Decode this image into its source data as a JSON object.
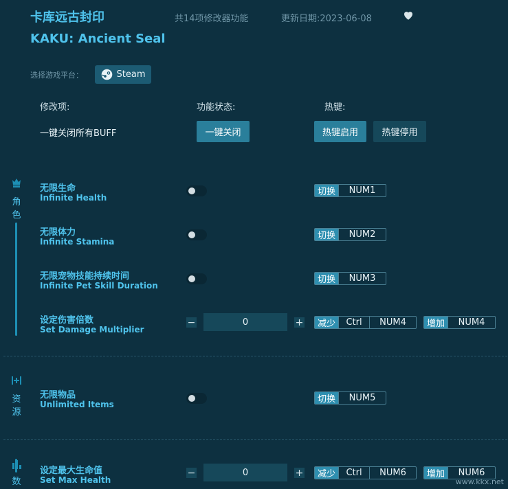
{
  "header": {
    "title_cn": "卡库远古封印",
    "title_en": "KAKU: Ancient Seal",
    "feature_count": "共14项修改器功能",
    "update_date": "更新日期:2023-06-08"
  },
  "platform": {
    "label": "选择游戏平台：",
    "steam_label": "Steam"
  },
  "columns": {
    "option": "修改项:",
    "status": "功能状态:",
    "hotkey": "热键:"
  },
  "global": {
    "label": "一键关闭所有BUFF",
    "close_all_button": "一键关闭",
    "hotkey_enable_button": "热键启用",
    "hotkey_disable_button": "热键停用"
  },
  "categories": [
    {
      "name": [
        "角",
        "色"
      ],
      "icon": "character-icon"
    },
    {
      "name": [
        "资",
        "源"
      ],
      "icon": "resource-icon"
    },
    {
      "name": [
        "数"
      ],
      "icon": "stats-icon"
    }
  ],
  "options": [
    {
      "cn": "无限生命",
      "en": "Infinite Health",
      "tag": "切换",
      "key": "NUM1",
      "enabled": false
    },
    {
      "cn": "无限体力",
      "en": "Infinite Stamina",
      "tag": "切换",
      "key": "NUM2",
      "enabled": false
    },
    {
      "cn": "无限宠物技能持续时间",
      "en": "Infinite Pet Skill Duration",
      "tag": "切换",
      "key": "NUM3",
      "enabled": false
    },
    {
      "cn": "设定伤害倍数",
      "en": "Set Damage Multiplier",
      "value": "0",
      "dec": {
        "tag": "减少",
        "mod": "Ctrl",
        "key": "NUM4"
      },
      "inc": {
        "tag": "增加",
        "key": "NUM4"
      }
    },
    {
      "cn": "无限物品",
      "en": "Unlimited Items",
      "tag": "切换",
      "key": "NUM5",
      "enabled": false
    },
    {
      "cn": "设定最大生命值",
      "en": "Set Max Health",
      "value": "0",
      "dec": {
        "tag": "减少",
        "mod": "Ctrl",
        "key": "NUM6"
      },
      "inc": {
        "tag": "增加",
        "key": "NUM6"
      }
    }
  ],
  "stepper": {
    "minus": "−",
    "plus": "+"
  },
  "watermark": "www.kkx.net",
  "colors": {
    "background": "#0d3040",
    "accent": "#4fc3ec",
    "button": "#2a7f9b"
  }
}
